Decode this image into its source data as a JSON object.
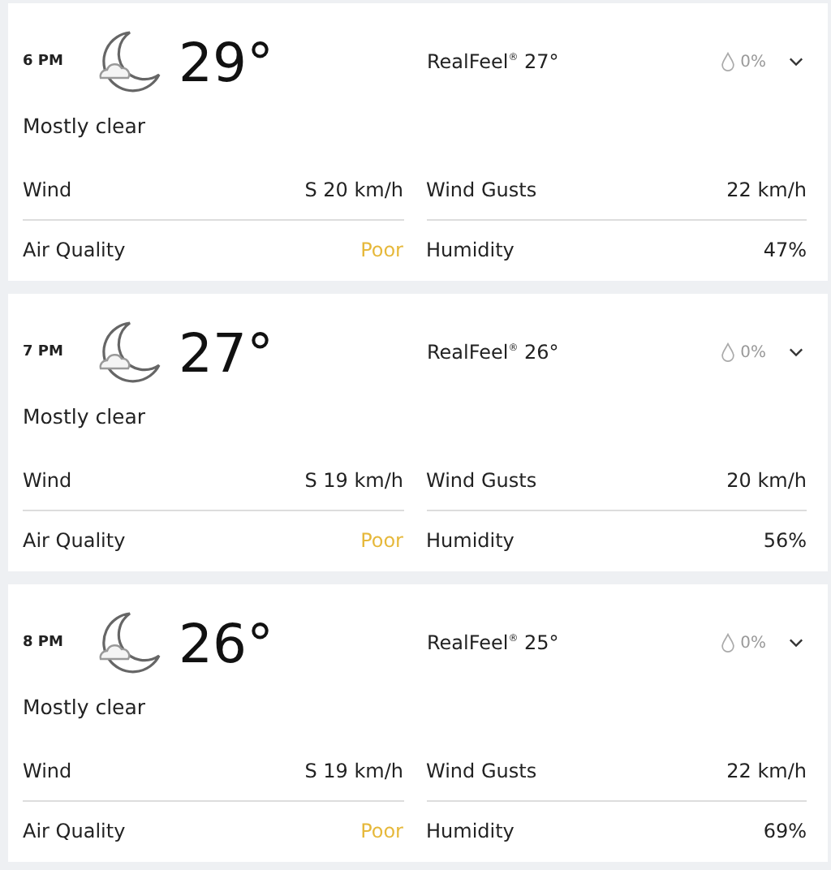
{
  "hours": [
    {
      "time": "6 PM",
      "temperature": "29°",
      "realfeel": "RealFeel$^{®}$ 27°",
      "precipitation": "0%",
      "condition": "Mostly clear",
      "details": [
        {
          "label": "Wind",
          "value": "S 20 km/h"
        },
        {
          "label": "Wind Gusts",
          "value": "22 km/h"
        },
        {
          "label": "Air Quality",
          "value": "Poor",
          "kind": "rating"
        },
        {
          "label": "Humidity",
          "value": "47%"
        }
      ]
    },
    {
      "time": "7 PM",
      "temperature": "27°",
      "realfeel": "RealFeel$^{®}$ 26°",
      "precipitation": "0%",
      "condition": "Mostly clear",
      "details": [
        {
          "label": "Wind",
          "value": "S 19 km/h"
        },
        {
          "label": "Wind Gusts",
          "value": "20 km/h"
        },
        {
          "label": "Air Quality",
          "value": "Poor",
          "kind": "rating"
        },
        {
          "label": "Humidity",
          "value": "56%"
        }
      ]
    },
    {
      "time": "8 PM",
      "temperature": "26°",
      "realfeel": "RealFeel$^{®}$ 25°",
      "precipitation": "0%",
      "condition": "Mostly clear",
      "details": [
        {
          "label": "Wind",
          "value": "S 19 km/h"
        },
        {
          "label": "Wind Gusts",
          "value": "22 km/h"
        },
        {
          "label": "Air Quality",
          "value": "Poor",
          "kind": "rating"
        },
        {
          "label": "Humidity",
          "value": "69%"
        }
      ]
    }
  ]
}
